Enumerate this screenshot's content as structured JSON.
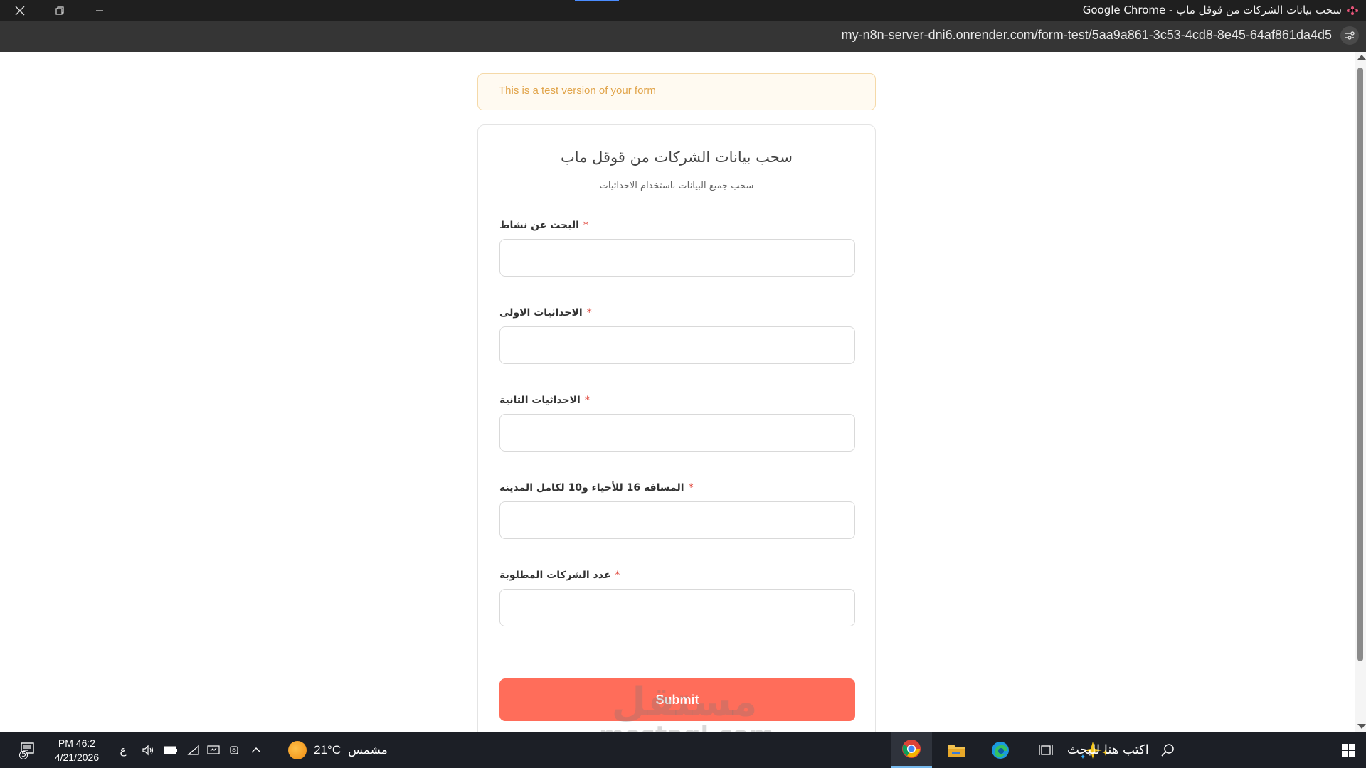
{
  "window": {
    "title": "سحب بيانات الشركات من قوقل ماب - Google Chrome",
    "close_icon": "close-icon",
    "restore_icon": "restore-icon",
    "minimize_icon": "minimize-icon"
  },
  "address_bar": {
    "url": "my-n8n-server-dni6.onrender.com/form-test/5aa9a861-3c53-4cd8-8e45-64af861da4d5"
  },
  "banner": {
    "text": "This is a test version of your form"
  },
  "form": {
    "title": "سحب بيانات الشركات من قوقل ماب",
    "subtitle": "سحب جميع البيانات باستخدام الاحداثيات",
    "required_marker": "*",
    "fields": [
      {
        "label": "البحث عن نشاط",
        "value": ""
      },
      {
        "label": "الاحداثيات الاولى",
        "value": ""
      },
      {
        "label": "الاحداثيات الثانية",
        "value": ""
      },
      {
        "label": "المسافة 16 للأحياء و10 لكامل المدينة",
        "value": ""
      },
      {
        "label": "عدد الشركات المطلوبة",
        "value": ""
      }
    ],
    "submit_label": "Submit"
  },
  "watermark": {
    "arabic": "مستقل",
    "latin": "mostaql.com"
  },
  "taskbar": {
    "notification_count": "5",
    "time": "PM 46:2",
    "date": "4/21/2026",
    "language": "ع",
    "weather_temp": "21°C",
    "weather_text": "مشمس",
    "search_placeholder": "اكتب هنا للبحث"
  },
  "colors": {
    "submit": "#ff6d5a",
    "banner_text": "#e1a44a",
    "required": "#e0463b"
  }
}
